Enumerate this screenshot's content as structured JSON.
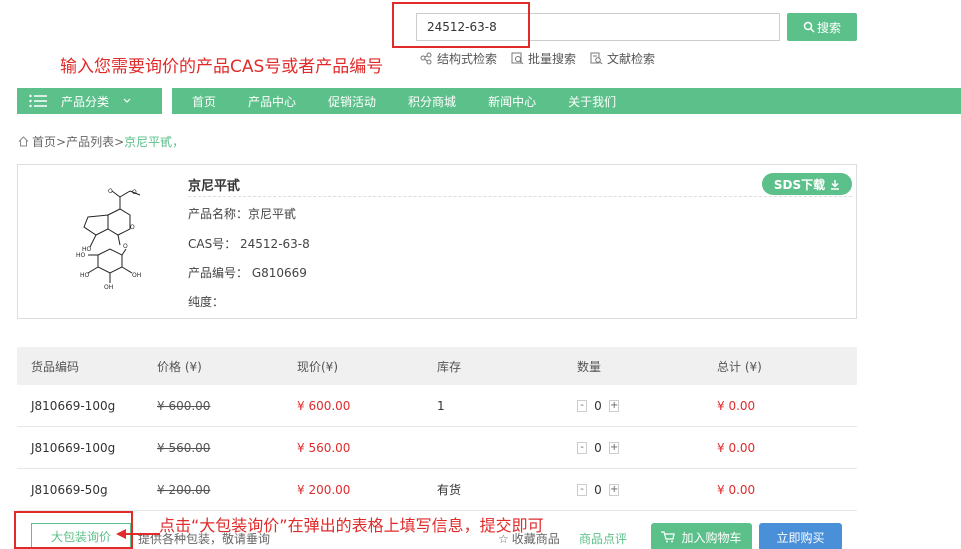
{
  "search": {
    "value": "24512-63-8",
    "button_label": "搜索"
  },
  "annotation_top": "输入您需要询价的产品CAS号或者产品编号",
  "search_links": [
    {
      "label": "结构式检索",
      "icon": "structure-icon"
    },
    {
      "label": "批量搜索",
      "icon": "batch-search-icon"
    },
    {
      "label": "文献检索",
      "icon": "literature-icon"
    }
  ],
  "nav": {
    "category_label": "产品分类",
    "items": [
      "首页",
      "产品中心",
      "促销活动",
      "积分商城",
      "新闻中心",
      "关于我们"
    ]
  },
  "breadcrumb": {
    "home": "首页",
    "sep": ">",
    "list": "产品列表",
    "current": "京尼平甙，"
  },
  "product": {
    "title": "京尼平甙",
    "sds_label": "SDS下载",
    "name_line": "产品名称：京尼平甙",
    "cas_line": "CAS号： 24512-63-8",
    "code_line": "产品编号： G810669",
    "purity_line": "纯度："
  },
  "table": {
    "headers": [
      "货品编码",
      "价格 (¥)",
      "现价(¥)",
      "库存",
      "数量",
      "总计 (¥)"
    ],
    "rows": [
      {
        "code": "J810669-100g",
        "price": "¥ 600.00",
        "now": "¥ 600.00",
        "stock": "1",
        "qty": "0",
        "total": "¥ 0.00"
      },
      {
        "code": "J810669-100g",
        "price": "¥ 560.00",
        "now": "¥ 560.00",
        "stock": "",
        "qty": "0",
        "total": "¥ 0.00"
      },
      {
        "code": "J810669-50g",
        "price": "¥ 200.00",
        "now": "¥ 200.00",
        "stock": "有货",
        "qty": "0",
        "total": "¥ 0.00"
      }
    ]
  },
  "actions": {
    "bulk_label": "大包装询价",
    "bulk_note": "提供各种包装，敬请垂询",
    "favorite": "收藏商品",
    "review": "商品点评",
    "cart": "加入购物车",
    "buy": "立即购买"
  },
  "annotation_bottom": "点击“大包装询价”在弹出的表格上填写信息，提交即可",
  "colors": {
    "accent": "#5cc08a",
    "annotation": "#e02b2b",
    "buy": "#4a90d9"
  }
}
